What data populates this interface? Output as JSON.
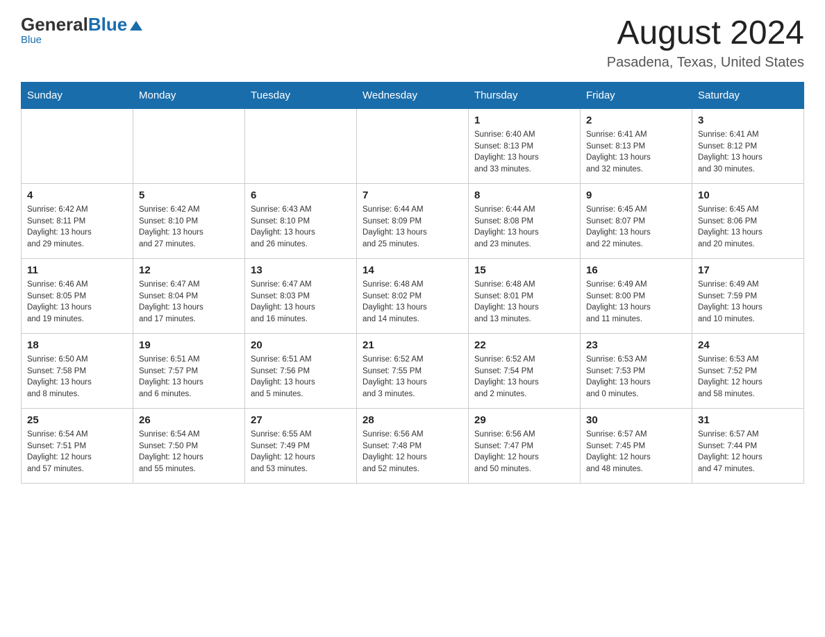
{
  "logo": {
    "general": "General",
    "blue": "Blue",
    "tagline": "Blue"
  },
  "header": {
    "month_year": "August 2024",
    "location": "Pasadena, Texas, United States"
  },
  "weekdays": [
    "Sunday",
    "Monday",
    "Tuesday",
    "Wednesday",
    "Thursday",
    "Friday",
    "Saturday"
  ],
  "weeks": [
    [
      {
        "day": "",
        "info": ""
      },
      {
        "day": "",
        "info": ""
      },
      {
        "day": "",
        "info": ""
      },
      {
        "day": "",
        "info": ""
      },
      {
        "day": "1",
        "info": "Sunrise: 6:40 AM\nSunset: 8:13 PM\nDaylight: 13 hours\nand 33 minutes."
      },
      {
        "day": "2",
        "info": "Sunrise: 6:41 AM\nSunset: 8:13 PM\nDaylight: 13 hours\nand 32 minutes."
      },
      {
        "day": "3",
        "info": "Sunrise: 6:41 AM\nSunset: 8:12 PM\nDaylight: 13 hours\nand 30 minutes."
      }
    ],
    [
      {
        "day": "4",
        "info": "Sunrise: 6:42 AM\nSunset: 8:11 PM\nDaylight: 13 hours\nand 29 minutes."
      },
      {
        "day": "5",
        "info": "Sunrise: 6:42 AM\nSunset: 8:10 PM\nDaylight: 13 hours\nand 27 minutes."
      },
      {
        "day": "6",
        "info": "Sunrise: 6:43 AM\nSunset: 8:10 PM\nDaylight: 13 hours\nand 26 minutes."
      },
      {
        "day": "7",
        "info": "Sunrise: 6:44 AM\nSunset: 8:09 PM\nDaylight: 13 hours\nand 25 minutes."
      },
      {
        "day": "8",
        "info": "Sunrise: 6:44 AM\nSunset: 8:08 PM\nDaylight: 13 hours\nand 23 minutes."
      },
      {
        "day": "9",
        "info": "Sunrise: 6:45 AM\nSunset: 8:07 PM\nDaylight: 13 hours\nand 22 minutes."
      },
      {
        "day": "10",
        "info": "Sunrise: 6:45 AM\nSunset: 8:06 PM\nDaylight: 13 hours\nand 20 minutes."
      }
    ],
    [
      {
        "day": "11",
        "info": "Sunrise: 6:46 AM\nSunset: 8:05 PM\nDaylight: 13 hours\nand 19 minutes."
      },
      {
        "day": "12",
        "info": "Sunrise: 6:47 AM\nSunset: 8:04 PM\nDaylight: 13 hours\nand 17 minutes."
      },
      {
        "day": "13",
        "info": "Sunrise: 6:47 AM\nSunset: 8:03 PM\nDaylight: 13 hours\nand 16 minutes."
      },
      {
        "day": "14",
        "info": "Sunrise: 6:48 AM\nSunset: 8:02 PM\nDaylight: 13 hours\nand 14 minutes."
      },
      {
        "day": "15",
        "info": "Sunrise: 6:48 AM\nSunset: 8:01 PM\nDaylight: 13 hours\nand 13 minutes."
      },
      {
        "day": "16",
        "info": "Sunrise: 6:49 AM\nSunset: 8:00 PM\nDaylight: 13 hours\nand 11 minutes."
      },
      {
        "day": "17",
        "info": "Sunrise: 6:49 AM\nSunset: 7:59 PM\nDaylight: 13 hours\nand 10 minutes."
      }
    ],
    [
      {
        "day": "18",
        "info": "Sunrise: 6:50 AM\nSunset: 7:58 PM\nDaylight: 13 hours\nand 8 minutes."
      },
      {
        "day": "19",
        "info": "Sunrise: 6:51 AM\nSunset: 7:57 PM\nDaylight: 13 hours\nand 6 minutes."
      },
      {
        "day": "20",
        "info": "Sunrise: 6:51 AM\nSunset: 7:56 PM\nDaylight: 13 hours\nand 5 minutes."
      },
      {
        "day": "21",
        "info": "Sunrise: 6:52 AM\nSunset: 7:55 PM\nDaylight: 13 hours\nand 3 minutes."
      },
      {
        "day": "22",
        "info": "Sunrise: 6:52 AM\nSunset: 7:54 PM\nDaylight: 13 hours\nand 2 minutes."
      },
      {
        "day": "23",
        "info": "Sunrise: 6:53 AM\nSunset: 7:53 PM\nDaylight: 13 hours\nand 0 minutes."
      },
      {
        "day": "24",
        "info": "Sunrise: 6:53 AM\nSunset: 7:52 PM\nDaylight: 12 hours\nand 58 minutes."
      }
    ],
    [
      {
        "day": "25",
        "info": "Sunrise: 6:54 AM\nSunset: 7:51 PM\nDaylight: 12 hours\nand 57 minutes."
      },
      {
        "day": "26",
        "info": "Sunrise: 6:54 AM\nSunset: 7:50 PM\nDaylight: 12 hours\nand 55 minutes."
      },
      {
        "day": "27",
        "info": "Sunrise: 6:55 AM\nSunset: 7:49 PM\nDaylight: 12 hours\nand 53 minutes."
      },
      {
        "day": "28",
        "info": "Sunrise: 6:56 AM\nSunset: 7:48 PM\nDaylight: 12 hours\nand 52 minutes."
      },
      {
        "day": "29",
        "info": "Sunrise: 6:56 AM\nSunset: 7:47 PM\nDaylight: 12 hours\nand 50 minutes."
      },
      {
        "day": "30",
        "info": "Sunrise: 6:57 AM\nSunset: 7:45 PM\nDaylight: 12 hours\nand 48 minutes."
      },
      {
        "day": "31",
        "info": "Sunrise: 6:57 AM\nSunset: 7:44 PM\nDaylight: 12 hours\nand 47 minutes."
      }
    ]
  ]
}
